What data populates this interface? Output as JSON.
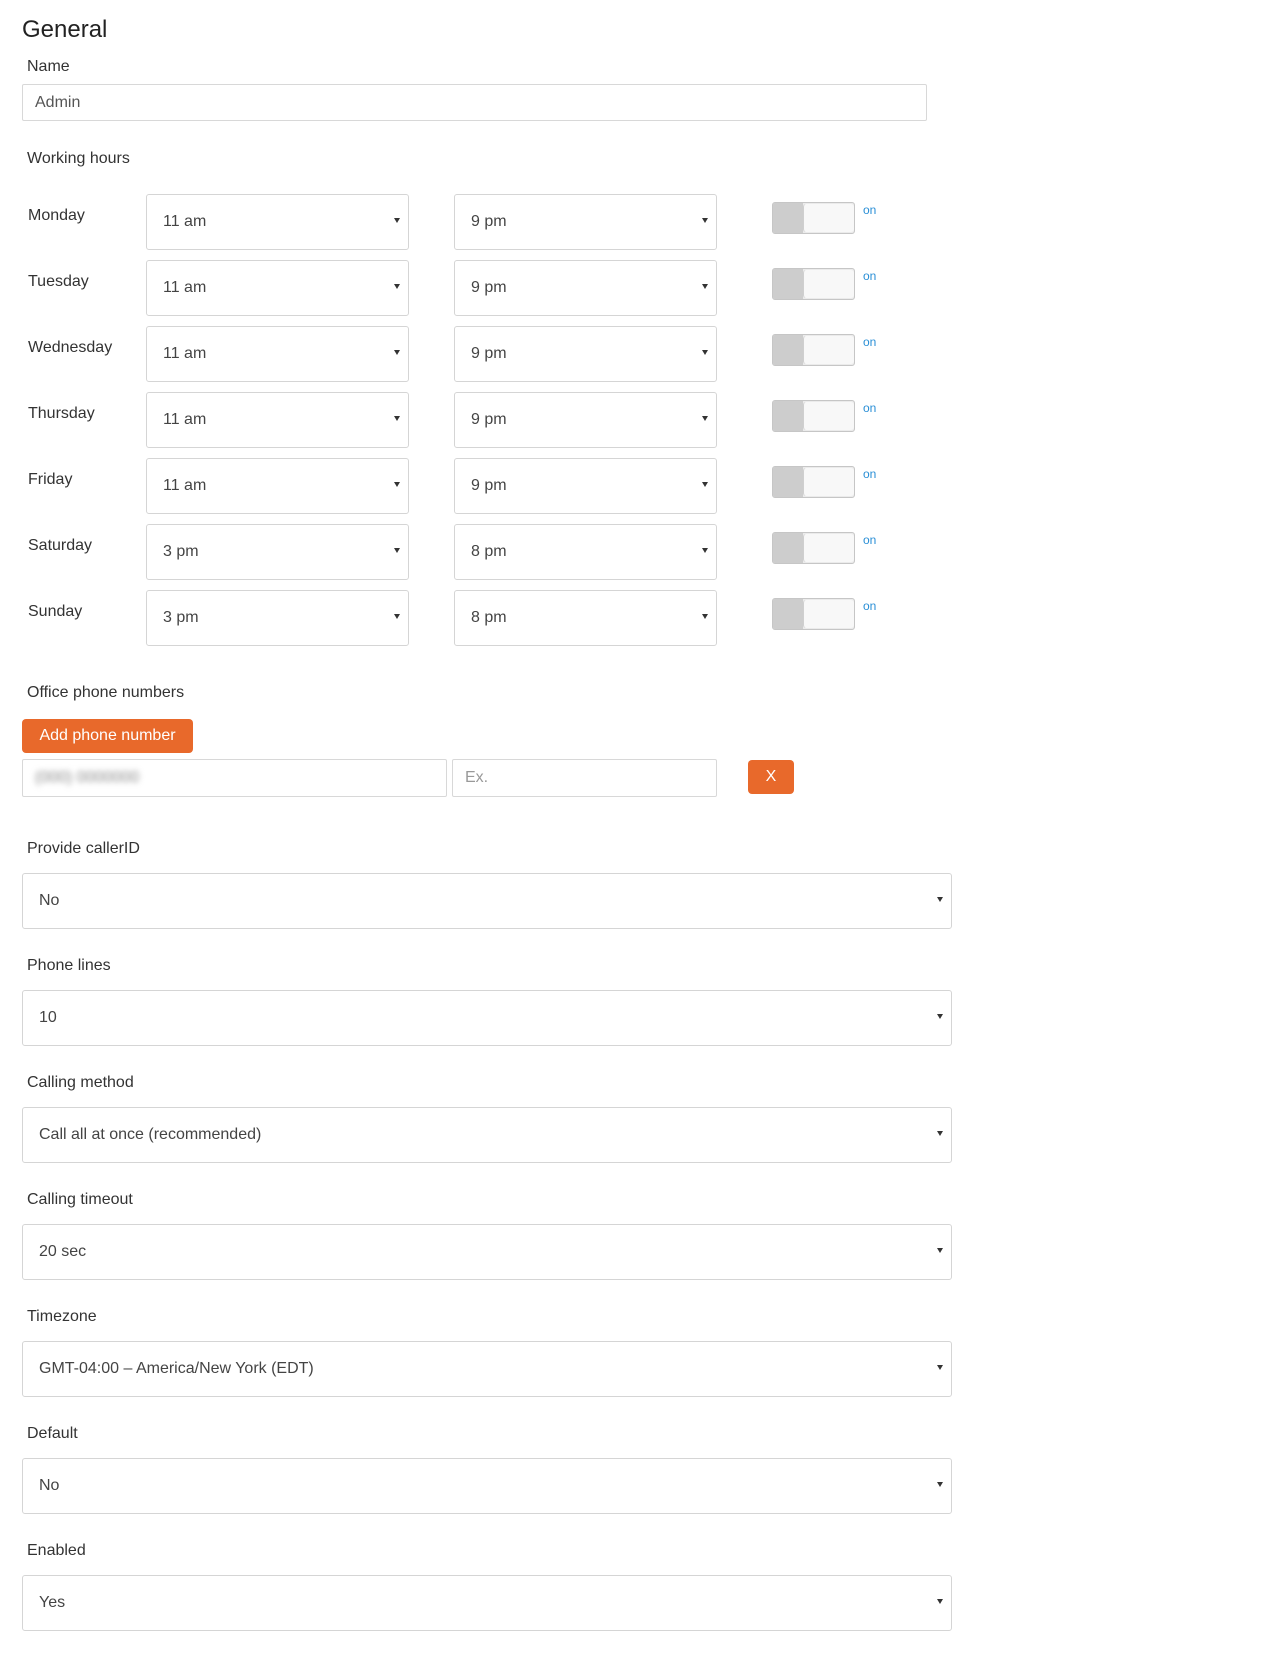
{
  "section_title": "General",
  "name": {
    "label": "Name",
    "value": "Admin"
  },
  "working_hours": {
    "label": "Working hours",
    "days": [
      {
        "day": "Monday",
        "from": "11 am",
        "to": "9 pm",
        "state": "on"
      },
      {
        "day": "Tuesday",
        "from": "11 am",
        "to": "9 pm",
        "state": "on"
      },
      {
        "day": "Wednesday",
        "from": "11 am",
        "to": "9 pm",
        "state": "on"
      },
      {
        "day": "Thursday",
        "from": "11 am",
        "to": "9 pm",
        "state": "on"
      },
      {
        "day": "Friday",
        "from": "11 am",
        "to": "9 pm",
        "state": "on"
      },
      {
        "day": "Saturday",
        "from": "3 pm",
        "to": "8 pm",
        "state": "on"
      },
      {
        "day": "Sunday",
        "from": "3 pm",
        "to": "8 pm",
        "state": "on"
      }
    ]
  },
  "office_phones": {
    "label": "Office phone numbers",
    "add_button": "Add phone number",
    "phone_value": "(000) 0000000",
    "ext_placeholder": "Ex.",
    "remove_button": "X"
  },
  "provide_caller_id": {
    "label": "Provide callerID",
    "value": "No"
  },
  "phone_lines": {
    "label": "Phone lines",
    "value": "10"
  },
  "calling_method": {
    "label": "Calling method",
    "value": "Call all at once (recommended)"
  },
  "calling_timeout": {
    "label": "Calling timeout",
    "value": "20 sec"
  },
  "timezone": {
    "label": "Timezone",
    "value": "GMT-04:00 – America/New York (EDT)"
  },
  "default": {
    "label": "Default",
    "value": "No"
  },
  "enabled": {
    "label": "Enabled",
    "value": "Yes"
  },
  "colors": {
    "accent_orange": "#e8692b",
    "toggle_on_text": "#2a8fd6"
  }
}
